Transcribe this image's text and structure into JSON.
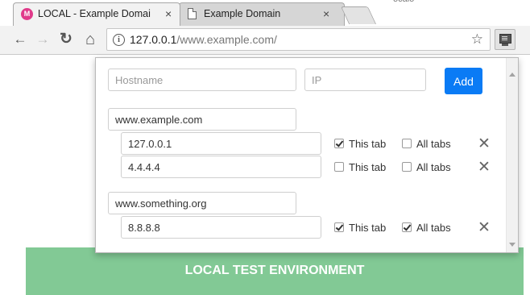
{
  "browser": {
    "tabs": [
      {
        "title": "LOCAL - Example Domai",
        "favicon": "local-favicon-icon",
        "favicon_glyph": "M",
        "close": "×",
        "active": true
      },
      {
        "title": "Example Domain",
        "favicon": "page-icon",
        "close": "×",
        "active": false
      }
    ],
    "partial_text": "ocalo",
    "nav": {
      "back": "←",
      "forward": "→",
      "reload": "↻",
      "home": "⌂"
    },
    "address": {
      "host": "127.0.0.1",
      "path": "/www.example.com/",
      "info_glyph": "i",
      "star": "☆"
    }
  },
  "popup": {
    "hostname_placeholder": "Hostname",
    "ip_placeholder": "IP",
    "add_label": "Add",
    "groups": [
      {
        "hostname": "www.example.com",
        "entries": [
          {
            "ip": "127.0.0.1",
            "this_tab": true,
            "all_tabs": false
          },
          {
            "ip": "4.4.4.4",
            "this_tab": false,
            "all_tabs": false
          }
        ]
      },
      {
        "hostname": "www.something.org",
        "entries": [
          {
            "ip": "8.8.8.8",
            "this_tab": true,
            "all_tabs": true
          }
        ]
      }
    ],
    "this_tab_label": "This tab",
    "all_tabs_label": "All tabs",
    "delete_glyph": "✕"
  },
  "page": {
    "banner_text": "LOCAL TEST ENVIRONMENT",
    "banner_color": "#82c995"
  },
  "colors": {
    "accent": "#0a7bf5"
  }
}
